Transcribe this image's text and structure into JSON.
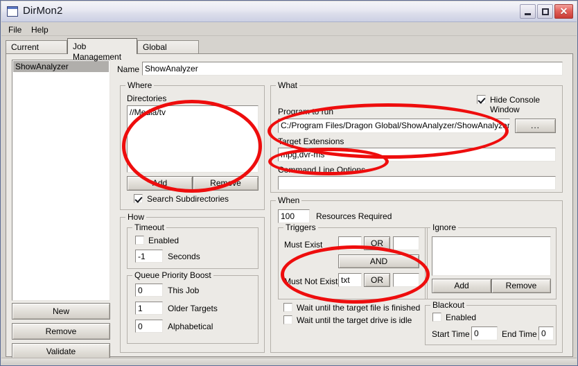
{
  "window": {
    "title": "DirMon2",
    "icon": "window-icon",
    "controls": {
      "minimize": "_",
      "maximize": "□",
      "close": "✕"
    }
  },
  "menubar": {
    "items": [
      {
        "label": "File"
      },
      {
        "label": "Help"
      }
    ]
  },
  "tabs": [
    {
      "label": "Current Status",
      "active": false
    },
    {
      "label": "Job Management",
      "active": true
    },
    {
      "label": "Global Settings",
      "active": false
    }
  ],
  "jobs": {
    "items": [
      "ShowAnalyzer"
    ],
    "selected": "ShowAnalyzer",
    "buttons": {
      "new": "New",
      "remove": "Remove",
      "validate": "Validate"
    }
  },
  "name_row": {
    "label": "Name",
    "value": "ShowAnalyzer",
    "placeholder": ""
  },
  "where": {
    "legend": "Where",
    "directories_label": "Directories",
    "directories": [
      "//Media/tv"
    ],
    "add_label": "Add",
    "remove_label": "Remove",
    "search_subdirectories": {
      "label": "Search Subdirectories",
      "checked": true
    }
  },
  "how": {
    "legend": "How",
    "timeout": {
      "legend": "Timeout",
      "enabled_label": "Enabled",
      "enabled": false,
      "seconds_value": "-1",
      "seconds_label": "Seconds"
    },
    "queue_priority_boost": {
      "legend": "Queue Priority Boost",
      "rows": [
        {
          "value": "0",
          "label": "This Job"
        },
        {
          "value": "1",
          "label": "Older Targets"
        },
        {
          "value": "0",
          "label": "Alphabetical"
        }
      ]
    }
  },
  "what": {
    "legend": "What",
    "hide_console": {
      "label": "Hide Console Window",
      "checked": true
    },
    "program_label": "Program to run",
    "program_value": "C:/Program Files/Dragon Global/ShowAnalyzer/ShowAnalyzer.exe",
    "browse_label": "...",
    "extensions_label": "Target Extensions",
    "extensions_value": "mpg,dvr-ms",
    "cmdline_label": "Command Line Options",
    "cmdline_value": ""
  },
  "when": {
    "legend": "When",
    "resources_value": "100",
    "resources_label": "Resources Required",
    "triggers": {
      "legend": "Triggers",
      "must_exist_label": "Must Exist",
      "must_exist_first": "",
      "must_exist_or": "OR",
      "must_exist_second": "",
      "and_label": "AND",
      "must_not_exist_label": "Must Not Exist",
      "must_not_exist_first": "txt",
      "must_not_exist_or": "OR",
      "must_not_exist_second": ""
    },
    "wait_file": {
      "label": "Wait until the target file is finished",
      "checked": false
    },
    "wait_drive": {
      "label": "Wait until the target drive is idle",
      "checked": false
    }
  },
  "ignore": {
    "legend": "Ignore",
    "items": [],
    "add_label": "Add",
    "remove_label": "Remove"
  },
  "blackout": {
    "legend": "Blackout",
    "enabled_label": "Enabled",
    "enabled": false,
    "start_label": "Start Time",
    "start_value": "0",
    "end_label": "End Time",
    "end_value": "0"
  },
  "annotations": {
    "color": "#ee0d0d",
    "ellipses": [
      {
        "name": "directories-highlight"
      },
      {
        "name": "program-to-run-highlight"
      },
      {
        "name": "target-extensions-highlight"
      },
      {
        "name": "triggers-highlight"
      }
    ]
  }
}
